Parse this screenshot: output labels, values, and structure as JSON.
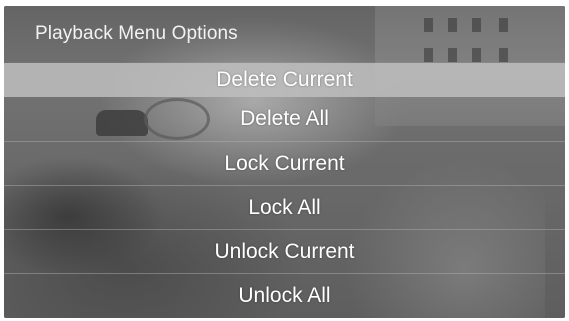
{
  "header": {
    "title": "Playback Menu Options"
  },
  "menu": {
    "items": [
      {
        "label": "Delete Current",
        "selected": true
      },
      {
        "label": "Delete All",
        "selected": false
      },
      {
        "label": "Lock Current",
        "selected": false
      },
      {
        "label": "Lock All",
        "selected": false
      },
      {
        "label": "Unlock Current",
        "selected": false
      },
      {
        "label": "Unlock All",
        "selected": false
      }
    ]
  },
  "colors": {
    "selected_bg": "#bebebe",
    "text": "#ffffff",
    "title": "#f2f2f2"
  }
}
